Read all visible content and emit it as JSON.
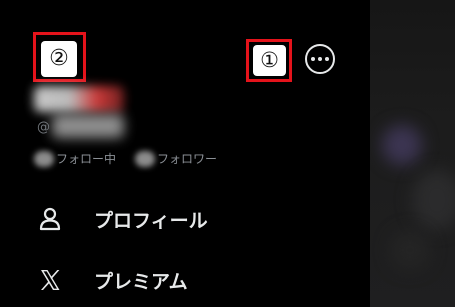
{
  "drawer": {
    "profile": {
      "handle_prefix": "@",
      "following_label": "フォロー中",
      "followers_label": "フォロワー"
    },
    "menu": [
      {
        "label": "プロフィール",
        "icon": "person-icon"
      },
      {
        "label": "プレミアム",
        "icon": "x-logo-icon"
      }
    ]
  },
  "annotations": {
    "marker_1": "①",
    "marker_2": "②",
    "color": "#e5131b"
  },
  "colors": {
    "background": "#000000",
    "text": "#e7e9ea",
    "secondary_text": "#71767b"
  }
}
